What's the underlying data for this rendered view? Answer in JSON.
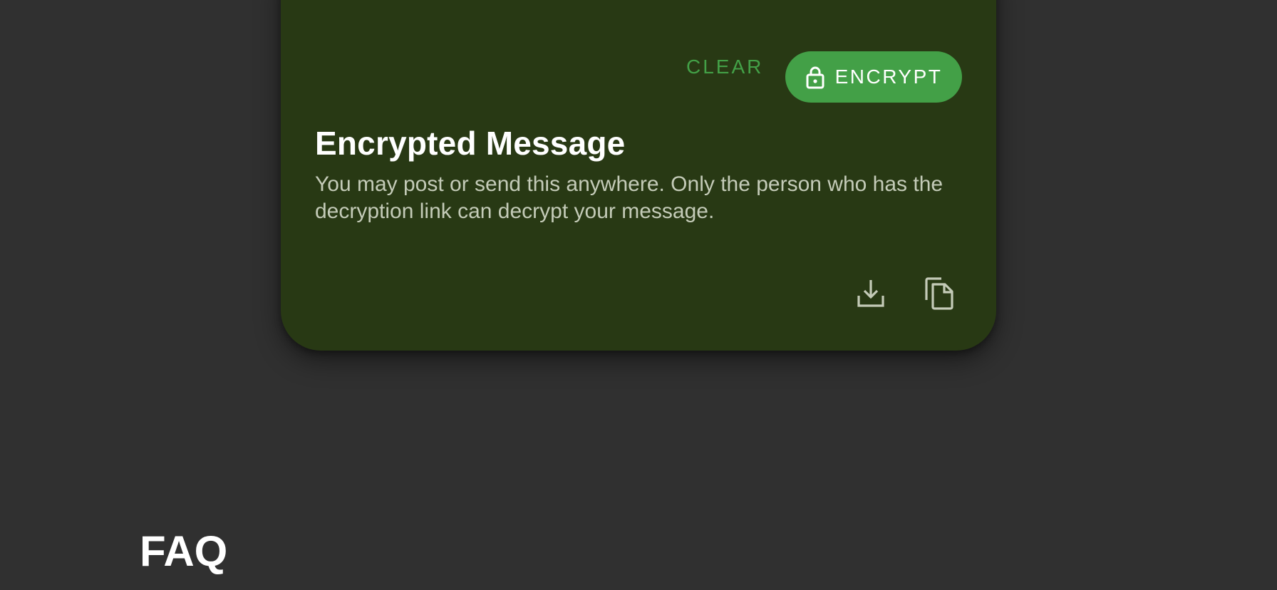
{
  "actions": {
    "clear_label": "CLEAR",
    "encrypt_label": "ENCRYPT"
  },
  "encrypted_section": {
    "title": "Encrypted Message",
    "description": "You may post or send this anywhere. Only the person who has the decryption link can decrypt your message."
  },
  "icons": {
    "lock": "lock-icon",
    "download": "download-icon",
    "copy": "copy-icon"
  },
  "faq": {
    "heading": "FAQ"
  },
  "colors": {
    "background": "#303030",
    "card": "#283914",
    "accent": "#43a047",
    "muted_text": "#c4cbb8"
  }
}
